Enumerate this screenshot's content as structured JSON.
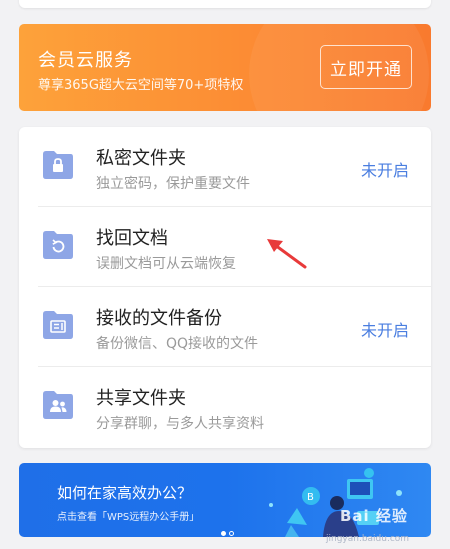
{
  "vip": {
    "title": "会员云服务",
    "subtitle": "尊享365G超大云空间等70+项特权",
    "button": "立即开通"
  },
  "list": [
    {
      "title": "私密文件夹",
      "desc": "独立密码，保护重要文件",
      "status": "未开启",
      "icon": "lock-folder-icon"
    },
    {
      "title": "找回文档",
      "desc": "误删文档可从云端恢复",
      "status": "",
      "icon": "restore-folder-icon"
    },
    {
      "title": "接收的文件备份",
      "desc": "备份微信、QQ接收的文件",
      "status": "未开启",
      "icon": "backup-folder-icon"
    },
    {
      "title": "共享文件夹",
      "desc": "分享群聊，与多人共享资料",
      "status": "",
      "icon": "shared-folder-icon"
    }
  ],
  "promo": {
    "title": "如何在家高效办公？",
    "subtitle": "点击查看「WPS远程办公手册」"
  },
  "watermark": {
    "text": "Bai 经验",
    "url": "jingyan.baidu.com"
  },
  "colors": {
    "accent": "#4a7ee0",
    "icon": "#8ea6e6",
    "vip_orange": "#fc8c34",
    "promo_blue": "#1f6fe8",
    "arrow_red": "#e83a3a"
  }
}
